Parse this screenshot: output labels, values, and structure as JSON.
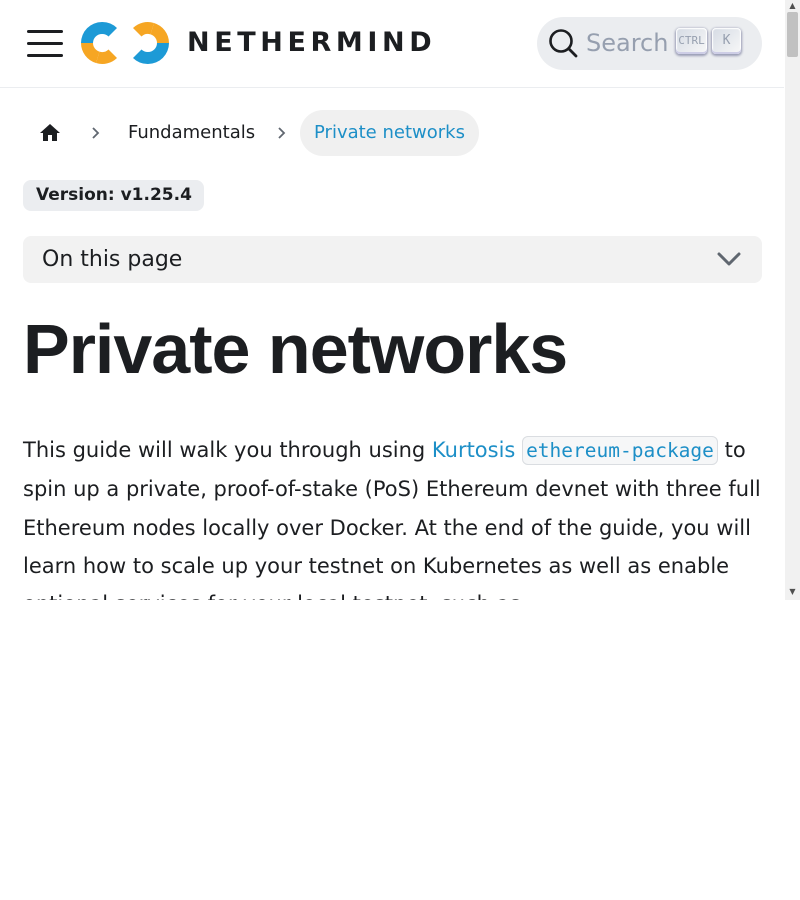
{
  "header": {
    "brand": "NETHERMIND",
    "search": {
      "placeholder": "Search",
      "shortcut_ctrl": "CTRL",
      "shortcut_key": "K"
    }
  },
  "breadcrumb": {
    "items": [
      "Fundamentals"
    ],
    "current": "Private networks"
  },
  "version_badge": "Version: v1.25.4",
  "toc": {
    "label": "On this page"
  },
  "article": {
    "title": "Private networks",
    "intro": {
      "text_before_link": "This guide will walk you through using ",
      "link_text": "Kurtosis",
      "code_text": "ethereum-package",
      "text_after_code": " to spin up a private, proof-of-stake (PoS) Ethereum devnet with three full Ethereum nodes locally over Docker. At the end of the guide, you will learn how to scale up your testnet on Kubernetes as well as enable optional services for your local testnet, such as"
    }
  },
  "colors": {
    "link": "#1d8fc7",
    "text": "#1c1e21",
    "logo_blue": "#1d8fc7",
    "logo_orange": "#f6a623"
  }
}
